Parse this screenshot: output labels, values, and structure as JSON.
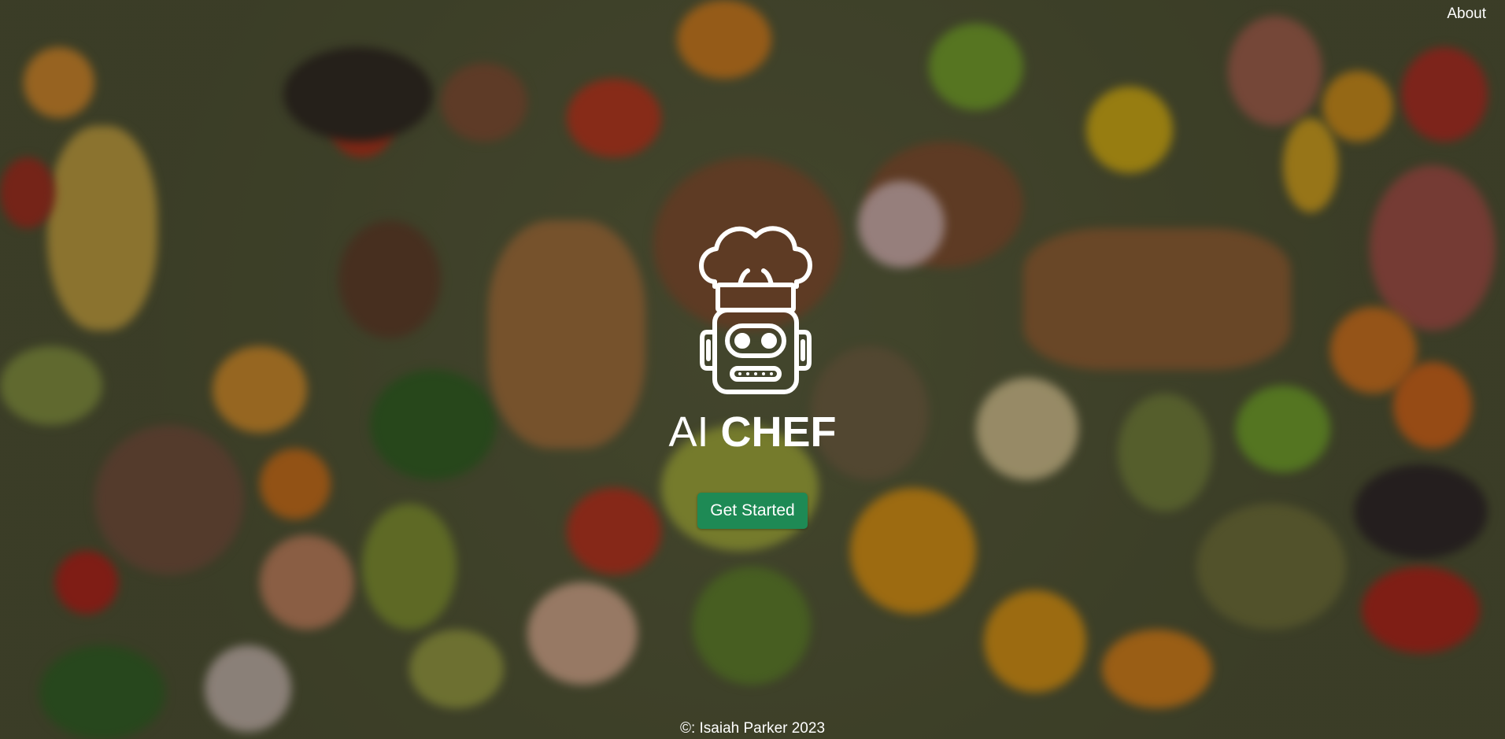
{
  "nav": {
    "about_label": "About"
  },
  "hero": {
    "logo_icon": "robot-chef-hat-icon",
    "brand_prefix": "AI",
    "brand_main": "CHEF",
    "cta_label": "Get Started"
  },
  "footer": {
    "text": "©: Isaiah Parker 2023"
  },
  "colors": {
    "cta_bg": "#1e8a55",
    "text": "#ffffff",
    "background": "#55593a"
  }
}
